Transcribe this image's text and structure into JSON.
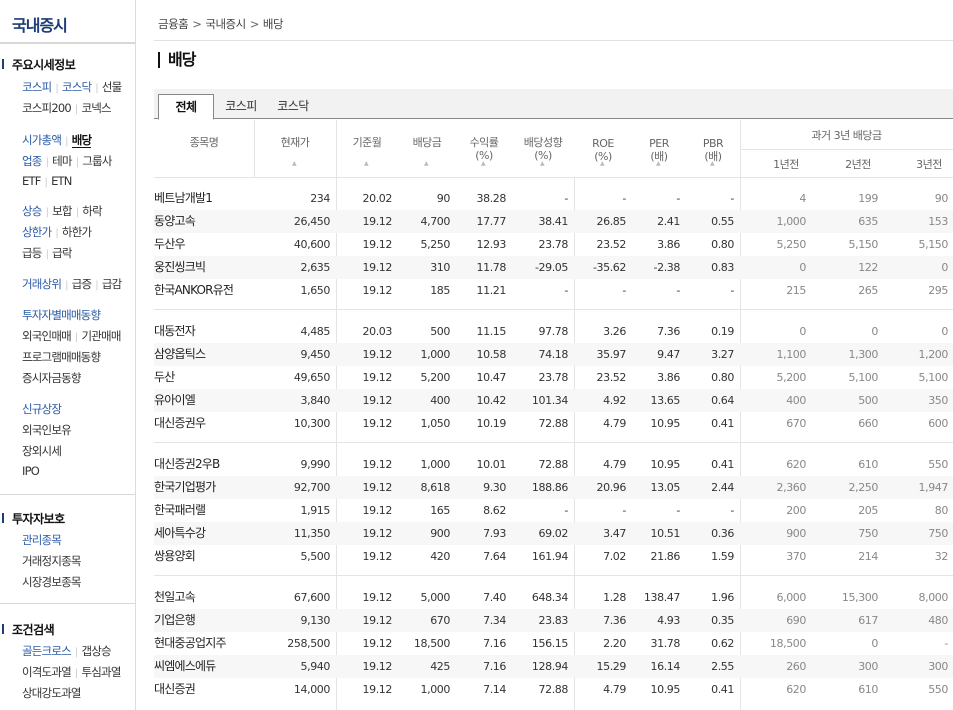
{
  "sidebar": {
    "title": "국내증시",
    "sections": [
      {
        "head": "주요시세정보",
        "rows": [
          [
            {
              "t": "코스피",
              "c": "blue"
            },
            {
              "t": "코스닥",
              "c": "blue"
            },
            {
              "t": "선물",
              "c": ""
            }
          ],
          [
            {
              "t": "코스피200",
              "c": ""
            },
            {
              "t": "코넥스",
              "c": ""
            }
          ],
          [
            {
              "t": "시가총액",
              "c": "blue"
            },
            {
              "t": "배당",
              "c": "active"
            }
          ],
          [
            {
              "t": "업종",
              "c": "blue"
            },
            {
              "t": "테마",
              "c": ""
            },
            {
              "t": "그룹사",
              "c": ""
            }
          ],
          [
            {
              "t": "ETF",
              "c": ""
            },
            {
              "t": "ETN",
              "c": ""
            }
          ],
          [
            {
              "t": "상승",
              "c": "blue"
            },
            {
              "t": "보합",
              "c": ""
            },
            {
              "t": "하락",
              "c": ""
            }
          ],
          [
            {
              "t": "상한가",
              "c": "blue"
            },
            {
              "t": "하한가",
              "c": ""
            }
          ],
          [
            {
              "t": "급등",
              "c": ""
            },
            {
              "t": "급락",
              "c": ""
            }
          ],
          [
            {
              "t": "거래상위",
              "c": "blue"
            },
            {
              "t": "급증",
              "c": ""
            },
            {
              "t": "급감",
              "c": ""
            }
          ],
          [
            {
              "t": "투자자별매매동향",
              "c": "blue"
            }
          ],
          [
            {
              "t": "외국인매매",
              "c": ""
            },
            {
              "t": "기관매매",
              "c": ""
            }
          ],
          [
            {
              "t": "프로그램매매동향",
              "c": ""
            }
          ],
          [
            {
              "t": "증시자금동향",
              "c": ""
            }
          ],
          [
            {
              "t": "신규상장",
              "c": "blue"
            }
          ],
          [
            {
              "t": "외국인보유",
              "c": ""
            }
          ],
          [
            {
              "t": "장외시세",
              "c": ""
            }
          ],
          [
            {
              "t": "IPO",
              "c": ""
            }
          ]
        ]
      },
      {
        "head": "투자자보호",
        "rows": [
          [
            {
              "t": "관리종목",
              "c": "blue"
            }
          ],
          [
            {
              "t": "거래정지종목",
              "c": ""
            }
          ],
          [
            {
              "t": "시장경보종목",
              "c": ""
            }
          ]
        ]
      },
      {
        "head": "조건검색",
        "rows": [
          [
            {
              "t": "골든크로스",
              "c": "blue"
            },
            {
              "t": "갭상승",
              "c": ""
            }
          ],
          [
            {
              "t": "이격도과열",
              "c": ""
            },
            {
              "t": "투심과열",
              "c": ""
            }
          ],
          [
            {
              "t": "상대강도과열",
              "c": ""
            }
          ]
        ]
      }
    ]
  },
  "breadcrumb": [
    "금융홈",
    "국내증시",
    "배당"
  ],
  "page_title": "배당",
  "tabs": [
    "전체",
    "코스피",
    "코스닥"
  ],
  "active_tab": "전체",
  "table": {
    "headers": {
      "name": "종목명",
      "price": "현재가",
      "base": "기준월",
      "dividend": "배당금",
      "yield": [
        "수익률",
        "(%)"
      ],
      "growth": [
        "배당성향",
        "(%)"
      ],
      "roe": [
        "ROE",
        "(%)"
      ],
      "per": [
        "PER",
        "(배)"
      ],
      "pbr": [
        "PBR",
        "(배)"
      ],
      "past_group": "과거 3년 배당금",
      "y1": "1년전",
      "y2": "2년전",
      "y3": "3년전"
    },
    "groups": [
      [
        [
          "베트남개발1",
          "234",
          "20.02",
          "90",
          "38.28",
          "-",
          "-",
          "-",
          "-",
          "4",
          "199",
          "90"
        ],
        [
          "동양고속",
          "26,450",
          "19.12",
          "4,700",
          "17.77",
          "38.41",
          "26.85",
          "2.41",
          "0.55",
          "1,000",
          "635",
          "153"
        ],
        [
          "두산우",
          "40,600",
          "19.12",
          "5,250",
          "12.93",
          "23.78",
          "23.52",
          "3.86",
          "0.80",
          "5,250",
          "5,150",
          "5,150"
        ],
        [
          "웅진씽크빅",
          "2,635",
          "19.12",
          "310",
          "11.78",
          "-29.05",
          "-35.62",
          "-2.38",
          "0.83",
          "0",
          "122",
          "0"
        ],
        [
          "한국ANKOR유전",
          "1,650",
          "19.12",
          "185",
          "11.21",
          "-",
          "-",
          "-",
          "-",
          "215",
          "265",
          "295"
        ]
      ],
      [
        [
          "대동전자",
          "4,485",
          "20.03",
          "500",
          "11.15",
          "97.78",
          "3.26",
          "7.36",
          "0.19",
          "0",
          "0",
          "0"
        ],
        [
          "삼양옵틱스",
          "9,450",
          "19.12",
          "1,000",
          "10.58",
          "74.18",
          "35.97",
          "9.47",
          "3.27",
          "1,100",
          "1,300",
          "1,200"
        ],
        [
          "두산",
          "49,650",
          "19.12",
          "5,200",
          "10.47",
          "23.78",
          "23.52",
          "3.86",
          "0.80",
          "5,200",
          "5,100",
          "5,100"
        ],
        [
          "유아이엘",
          "3,840",
          "19.12",
          "400",
          "10.42",
          "101.34",
          "4.92",
          "13.65",
          "0.64",
          "400",
          "500",
          "350"
        ],
        [
          "대신증권우",
          "10,300",
          "19.12",
          "1,050",
          "10.19",
          "72.88",
          "4.79",
          "10.95",
          "0.41",
          "670",
          "660",
          "600"
        ]
      ],
      [
        [
          "대신증권2우B",
          "9,990",
          "19.12",
          "1,000",
          "10.01",
          "72.88",
          "4.79",
          "10.95",
          "0.41",
          "620",
          "610",
          "550"
        ],
        [
          "한국기업평가",
          "92,700",
          "19.12",
          "8,618",
          "9.30",
          "188.86",
          "20.96",
          "13.05",
          "2.44",
          "2,360",
          "2,250",
          "1,947"
        ],
        [
          "한국패러랠",
          "1,915",
          "19.12",
          "165",
          "8.62",
          "-",
          "-",
          "-",
          "-",
          "200",
          "205",
          "80"
        ],
        [
          "세아특수강",
          "11,350",
          "19.12",
          "900",
          "7.93",
          "69.02",
          "3.47",
          "10.51",
          "0.36",
          "900",
          "750",
          "750"
        ],
        [
          "쌍용양회",
          "5,500",
          "19.12",
          "420",
          "7.64",
          "161.94",
          "7.02",
          "21.86",
          "1.59",
          "370",
          "214",
          "32"
        ]
      ],
      [
        [
          "천일고속",
          "67,600",
          "19.12",
          "5,000",
          "7.40",
          "648.34",
          "1.28",
          "138.47",
          "1.96",
          "6,000",
          "15,300",
          "8,000"
        ],
        [
          "기업은행",
          "9,130",
          "19.12",
          "670",
          "7.34",
          "23.83",
          "7.36",
          "4.93",
          "0.35",
          "690",
          "617",
          "480"
        ],
        [
          "현대중공업지주",
          "258,500",
          "19.12",
          "18,500",
          "7.16",
          "156.15",
          "2.20",
          "31.78",
          "0.62",
          "18,500",
          "0",
          "-"
        ],
        [
          "씨엠에스에듀",
          "5,940",
          "19.12",
          "425",
          "7.16",
          "128.94",
          "15.29",
          "16.14",
          "2.55",
          "260",
          "300",
          "300"
        ],
        [
          "대신증권",
          "14,000",
          "19.12",
          "1,000",
          "7.14",
          "72.88",
          "4.79",
          "10.95",
          "0.41",
          "620",
          "610",
          "550"
        ]
      ]
    ]
  }
}
